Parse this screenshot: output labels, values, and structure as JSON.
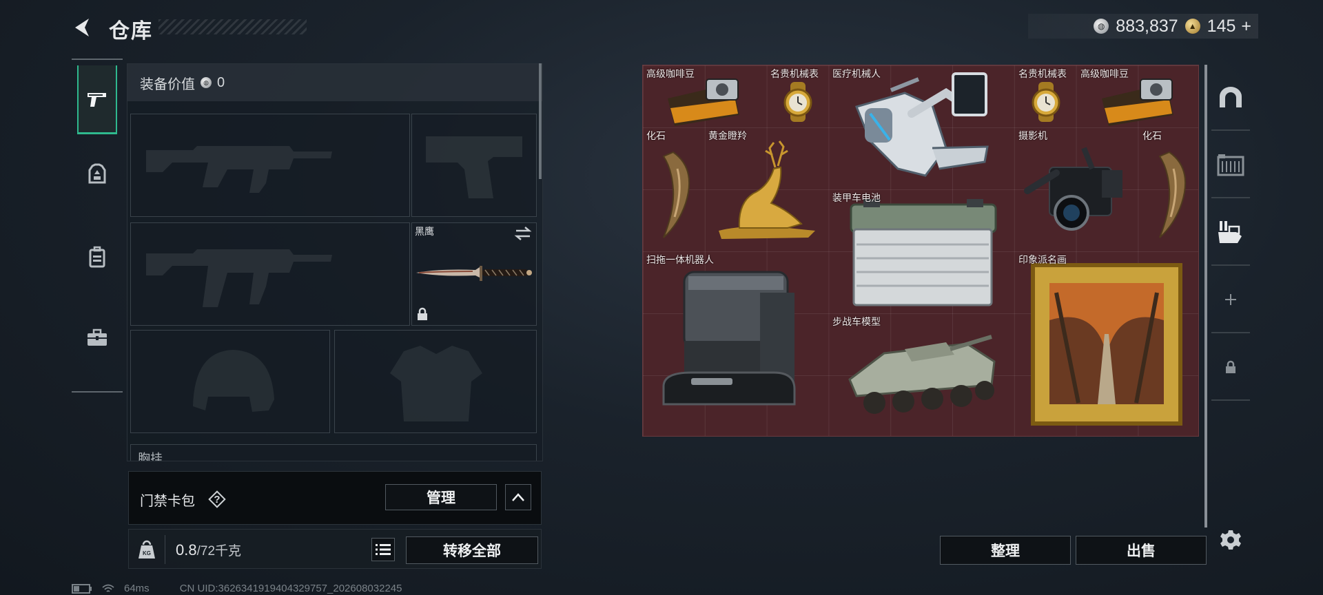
{
  "header": {
    "title": "仓库",
    "back_icon": "back-arrow-icon",
    "currencies": [
      {
        "icon": "silver-coin-icon",
        "value": "883,837"
      },
      {
        "icon": "gold-coin-icon",
        "value": "145"
      }
    ],
    "add_symbol": "+"
  },
  "left_rail": {
    "items": [
      {
        "name": "weapons",
        "icon": "pistol-icon",
        "active": true
      },
      {
        "name": "armor",
        "icon": "armor-plate-icon",
        "active": false
      },
      {
        "name": "backpack",
        "icon": "backpack-icon",
        "active": false
      },
      {
        "name": "case",
        "icon": "briefcase-icon",
        "active": false
      }
    ]
  },
  "equipment": {
    "value_label": "装备价值",
    "value": "0",
    "slots": {
      "primary_1": {
        "icon": "rifle-silhouette-icon"
      },
      "pistol": {
        "icon": "pistol-silhouette-icon"
      },
      "primary_2": {
        "icon": "rifle-silhouette-icon"
      },
      "melee": {
        "name": "黑鹰",
        "icon": "knife-icon",
        "locked": true
      },
      "helmet": {
        "icon": "helmet-silhouette-icon"
      },
      "vest": {
        "icon": "vest-silhouette-icon"
      }
    },
    "chest_rig_label": "胸挂"
  },
  "keycard": {
    "label": "门禁卡包",
    "help": "?",
    "manage_label": "管理"
  },
  "weight": {
    "current": "0.8",
    "capacity": "/72千克",
    "transfer_label": "转移全部"
  },
  "stash": {
    "items": [
      {
        "name": "高级咖啡豆",
        "icon": "coffee-beans-icon"
      },
      {
        "name": "名贵机械表",
        "icon": "gold-watch-icon"
      },
      {
        "name": "医疗机械人",
        "icon": "medical-robot-icon"
      },
      {
        "name": "名贵机械表",
        "icon": "gold-watch-icon"
      },
      {
        "name": "高级咖啡豆",
        "icon": "coffee-beans-icon"
      },
      {
        "name": "化石",
        "icon": "fossil-claw-icon"
      },
      {
        "name": "黄金瞪羚",
        "icon": "golden-gazelle-icon"
      },
      {
        "name": "摄影机",
        "icon": "video-camera-icon"
      },
      {
        "name": "化石",
        "icon": "fossil-claw-icon"
      },
      {
        "name": "装甲车电池",
        "icon": "car-battery-icon"
      },
      {
        "name": "扫拖一体机器人",
        "icon": "mop-robot-icon"
      },
      {
        "name": "步战车模型",
        "icon": "ifv-model-icon"
      },
      {
        "name": "印象派名画",
        "icon": "framed-painting-icon"
      }
    ]
  },
  "right_rail": {
    "items": [
      {
        "name": "stash-tab-1",
        "icon": "arch-icon"
      },
      {
        "name": "stash-tab-2",
        "icon": "crate-icon"
      },
      {
        "name": "stash-tab-3",
        "icon": "hand-cards-icon"
      },
      {
        "name": "add-tab",
        "icon": "plus-icon"
      },
      {
        "name": "locked-tab",
        "icon": "lock-icon"
      }
    ]
  },
  "actions": {
    "sort_label": "整理",
    "sell_label": "出售"
  },
  "status_bar": {
    "ping": "64ms",
    "uid": "CN UID:3626341919404329757_202608032245"
  },
  "colors": {
    "accent": "#2fb98e",
    "stash_bg": "#4b2429",
    "panel_bg": "#161d24"
  }
}
